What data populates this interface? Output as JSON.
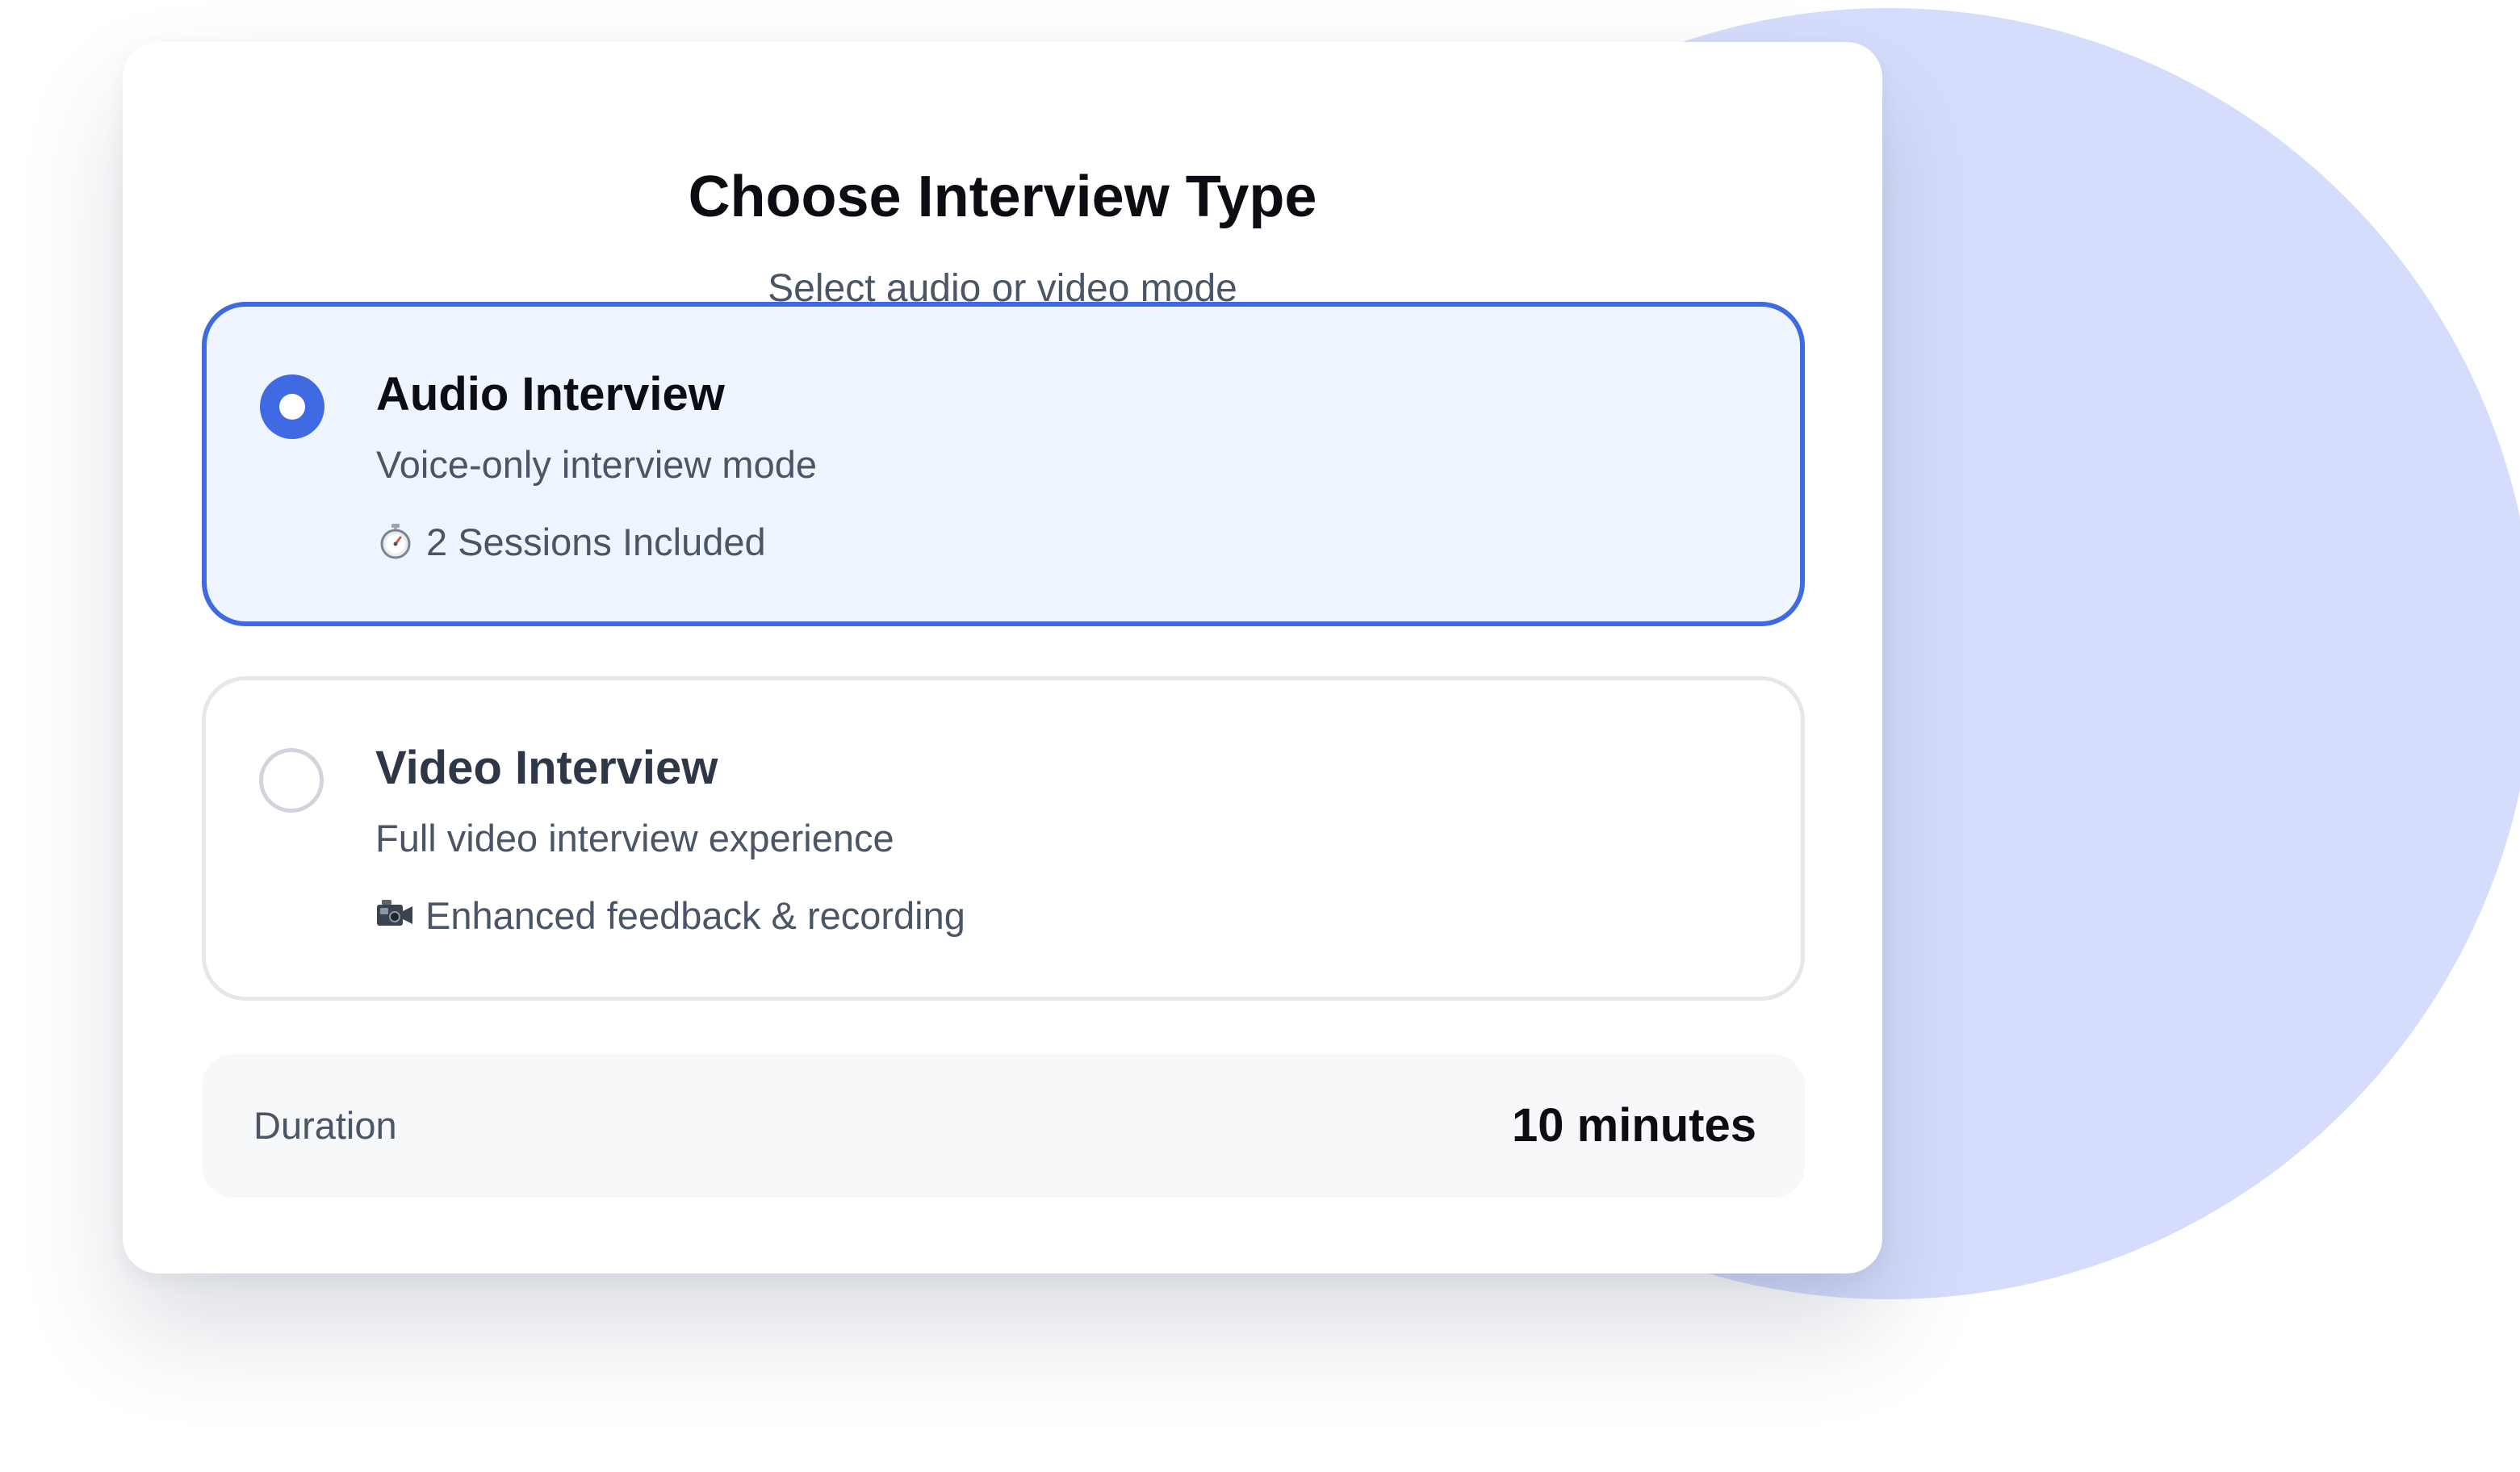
{
  "header": {
    "title": "Choose Interview Type",
    "subtitle": "Select audio or video mode"
  },
  "options": [
    {
      "title": "Audio Interview",
      "description": "Voice-only interview mode",
      "feature_icon": "stopwatch-icon",
      "feature": "2 Sessions Included",
      "selected": true
    },
    {
      "title": "Video Interview",
      "description": "Full video interview experience",
      "feature_icon": "video-camera-icon",
      "feature": "Enhanced feedback & recording",
      "selected": false
    }
  ],
  "duration": {
    "label": "Duration",
    "value": "10 minutes"
  },
  "colors": {
    "accent": "#3f6ae2",
    "selected_bg": "#eef5ff",
    "backdrop_circle": "#d6ddfc"
  }
}
